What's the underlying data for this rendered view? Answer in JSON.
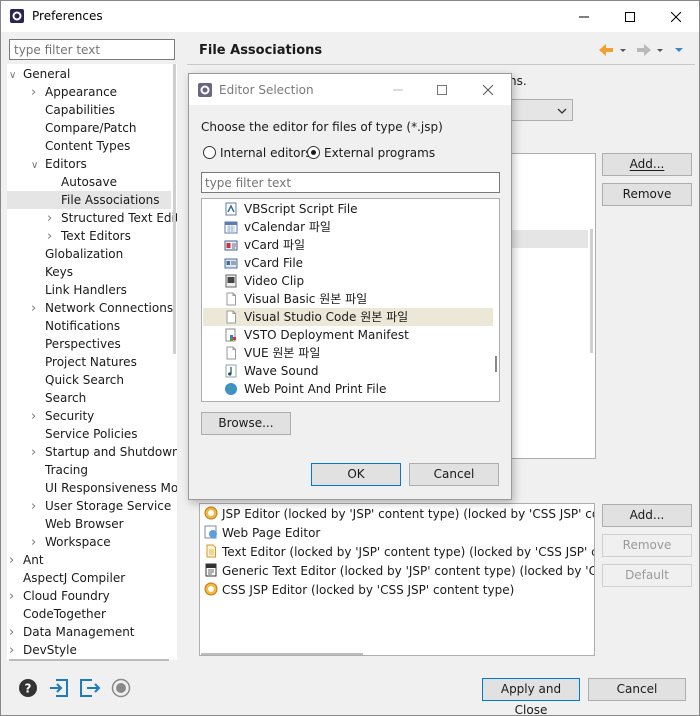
{
  "window": {
    "title": "Preferences"
  },
  "left": {
    "filter_placeholder": "type filter text",
    "tree": [
      {
        "label": "General",
        "indent": 0,
        "chevron": "down"
      },
      {
        "label": "Appearance",
        "indent": 1,
        "chevron": "right"
      },
      {
        "label": "Capabilities",
        "indent": 1,
        "chevron": ""
      },
      {
        "label": "Compare/Patch",
        "indent": 1,
        "chevron": ""
      },
      {
        "label": "Content Types",
        "indent": 1,
        "chevron": ""
      },
      {
        "label": "Editors",
        "indent": 1,
        "chevron": "down"
      },
      {
        "label": "Autosave",
        "indent": 2,
        "chevron": ""
      },
      {
        "label": "File Associations",
        "indent": 2,
        "chevron": "",
        "selected": true
      },
      {
        "label": "Structured Text Edit",
        "indent": 2,
        "chevron": "right"
      },
      {
        "label": "Text Editors",
        "indent": 2,
        "chevron": "right"
      },
      {
        "label": "Globalization",
        "indent": 1,
        "chevron": ""
      },
      {
        "label": "Keys",
        "indent": 1,
        "chevron": ""
      },
      {
        "label": "Link Handlers",
        "indent": 1,
        "chevron": ""
      },
      {
        "label": "Network Connections",
        "indent": 1,
        "chevron": "right"
      },
      {
        "label": "Notifications",
        "indent": 1,
        "chevron": ""
      },
      {
        "label": "Perspectives",
        "indent": 1,
        "chevron": ""
      },
      {
        "label": "Project Natures",
        "indent": 1,
        "chevron": ""
      },
      {
        "label": "Quick Search",
        "indent": 1,
        "chevron": ""
      },
      {
        "label": "Search",
        "indent": 1,
        "chevron": ""
      },
      {
        "label": "Security",
        "indent": 1,
        "chevron": "right"
      },
      {
        "label": "Service Policies",
        "indent": 1,
        "chevron": ""
      },
      {
        "label": "Startup and Shutdown",
        "indent": 1,
        "chevron": "right"
      },
      {
        "label": "Tracing",
        "indent": 1,
        "chevron": ""
      },
      {
        "label": "UI Responsiveness Mor",
        "indent": 1,
        "chevron": ""
      },
      {
        "label": "User Storage Service",
        "indent": 1,
        "chevron": "right"
      },
      {
        "label": "Web Browser",
        "indent": 1,
        "chevron": ""
      },
      {
        "label": "Workspace",
        "indent": 1,
        "chevron": "right"
      },
      {
        "label": "Ant",
        "indent": 0,
        "chevron": "right"
      },
      {
        "label": "AspectJ Compiler",
        "indent": 0,
        "chevron": ""
      },
      {
        "label": "Cloud Foundry",
        "indent": 0,
        "chevron": "right"
      },
      {
        "label": "CodeTogether",
        "indent": 0,
        "chevron": ""
      },
      {
        "label": "Data Management",
        "indent": 0,
        "chevron": "right"
      },
      {
        "label": "DevStyle",
        "indent": 0,
        "chevron": "right"
      }
    ]
  },
  "right": {
    "title": "File Associations",
    "partial_text": "ns.",
    "types_buttons": {
      "add": "Add...",
      "remove": "Remove"
    },
    "editor_buttons": {
      "add": "Add...",
      "remove": "Remove",
      "default": "Default"
    },
    "editors": [
      {
        "label": "JSP Editor (locked by 'JSP' content type) (locked by 'CSS JSP' conten",
        "icon": "jsp-editor-icon"
      },
      {
        "label": "Web Page Editor",
        "icon": "web-page-editor-icon"
      },
      {
        "label": "Text Editor (locked by 'JSP' content type) (locked by 'CSS JSP' conter",
        "icon": "text-editor-icon"
      },
      {
        "label": "Generic Text Editor (locked by 'JSP' content type) (locked by 'CSS JSI",
        "icon": "generic-text-editor-icon"
      },
      {
        "label": "CSS JSP Editor (locked by 'CSS JSP' content type)",
        "icon": "css-jsp-editor-icon"
      }
    ]
  },
  "bottom": {
    "apply_close": "Apply and Close",
    "cancel": "Cancel"
  },
  "dialog": {
    "title": "Editor Selection",
    "prompt": "Choose the editor for files of type (*.jsp)",
    "radio_internal": "Internal editors",
    "radio_external": "External programs",
    "selected_radio": "external",
    "filter_placeholder": "type filter text",
    "programs": [
      {
        "label": "VBScript Script File",
        "icon": "vbscript-icon"
      },
      {
        "label": "vCalendar 파일",
        "icon": "calendar-icon"
      },
      {
        "label": "vCard 파일",
        "icon": "vcard-icon"
      },
      {
        "label": "vCard File",
        "icon": "vcard-file-icon"
      },
      {
        "label": "Video Clip",
        "icon": "video-icon"
      },
      {
        "label": "Visual Basic 원본 파일",
        "icon": "document-icon"
      },
      {
        "label": "Visual Studio Code 원본 파일",
        "icon": "document-icon",
        "selected": true
      },
      {
        "label": "VSTO Deployment Manifest",
        "icon": "manifest-icon"
      },
      {
        "label": "VUE 원본 파일",
        "icon": "document-icon"
      },
      {
        "label": "Wave Sound",
        "icon": "sound-icon"
      },
      {
        "label": "Web Point And Print File",
        "icon": "globe-icon"
      }
    ],
    "browse": "Browse...",
    "ok": "OK",
    "cancel": "Cancel"
  }
}
